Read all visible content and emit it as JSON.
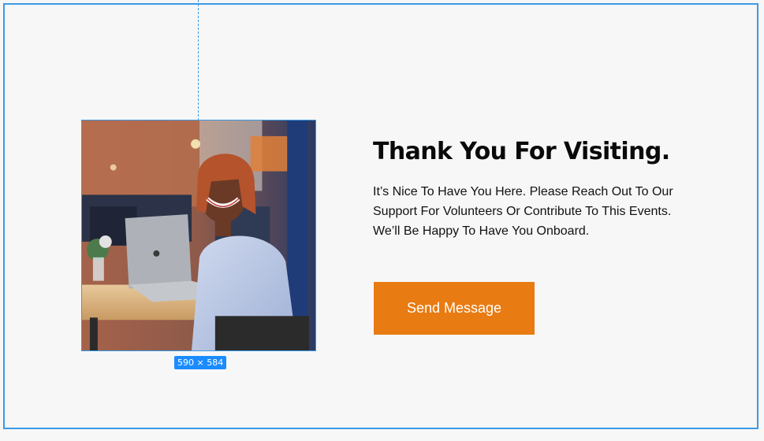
{
  "image": {
    "dimensions_label": "590 × 584",
    "alt_subject": "smiling woman with laptop at cafe table"
  },
  "content": {
    "heading": "Thank You For Visiting.",
    "body": "It’s Nice To Have You Here. Please Reach Out To Our Support For  Volunteers Or  Contribute To This Events. We’ll Be Happy To Have You Onboard."
  },
  "cta": {
    "label": "Send Message"
  },
  "colors": {
    "selection": "#3b9ae6",
    "badge": "#1a8cff",
    "button": "#e87b12",
    "background": "#f7f7f7"
  }
}
